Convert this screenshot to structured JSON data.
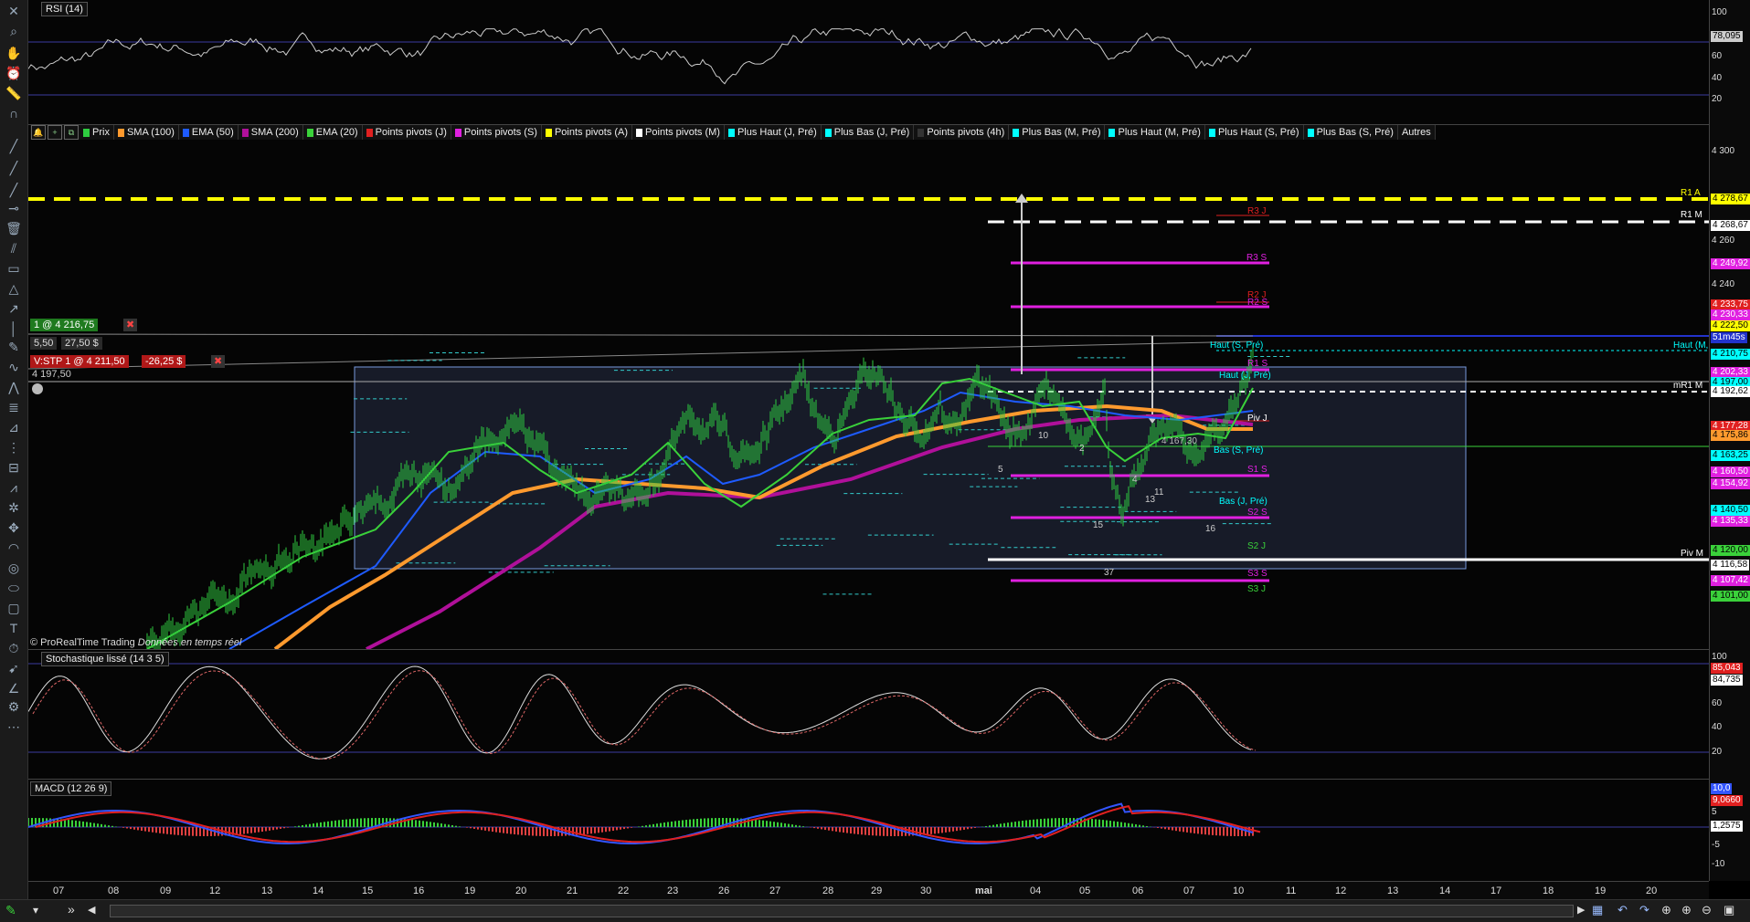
{
  "rsi_label": "RSI (14)",
  "stoch_label": "Stochastique lissé (14 3 5)",
  "macd_label": "MACD (12 26 9)",
  "watermark": "© ProRealTime Trading",
  "watermark_italic": "Données en temps réel",
  "legend": [
    {
      "label": "Prix",
      "color": "#2ecc40"
    },
    {
      "label": "SMA (100)",
      "color": "#ff9a2e"
    },
    {
      "label": "EMA (50)",
      "color": "#1e5bff"
    },
    {
      "label": "SMA (200)",
      "color": "#b0109a"
    },
    {
      "label": "EMA (20)",
      "color": "#3ad13a"
    },
    {
      "label": "Points pivots (J)",
      "color": "#e02020"
    },
    {
      "label": "Points pivots (S)",
      "color": "#e020e0"
    },
    {
      "label": "Points pivots (A)",
      "color": "#ffff00"
    },
    {
      "label": "Points pivots (M)",
      "color": "#ffffff"
    },
    {
      "label": "Plus Haut (J, Pré)",
      "color": "#00ffff"
    },
    {
      "label": "Plus Bas (J, Pré)",
      "color": "#00ffff"
    },
    {
      "label": "Points pivots (4h)",
      "color": "#333333"
    },
    {
      "label": "Plus Bas (M, Pré)",
      "color": "#00ffff"
    },
    {
      "label": "Plus Haut (M, Pré)",
      "color": "#00ffff"
    },
    {
      "label": "Plus Haut (S, Pré)",
      "color": "#00ffff"
    },
    {
      "label": "Plus Bas (S, Pré)",
      "color": "#00ffff"
    },
    {
      "label": "Autres",
      "color": ""
    }
  ],
  "orders": {
    "buy": "1 @ 4 216,75",
    "buy_sub1": "5,50",
    "buy_sub2": "27,50 $",
    "stop": "V:STP 1 @ 4 211,50",
    "stop_pnl": "-26,25 $",
    "line_price": "4 197,50"
  },
  "rsi_axis": [
    "100",
    "78,095",
    "60",
    "40",
    "20"
  ],
  "price_axis": [
    "4 300",
    "4 278,67",
    "4 268,67",
    "4 260",
    "4 249,92",
    "4 240",
    "4 233,75",
    "4 230,33",
    "4 222,50",
    "51m45s",
    "4 210,75",
    "4 202,33",
    "4 197,00",
    "4 192,62",
    "4 177,28",
    "4 175,86",
    "4 163,25",
    "4 160,50",
    "4 154,92",
    "4 140,50",
    "4 135,33",
    "4 120,00",
    "4 116,58",
    "4 107,42",
    "4 101,00"
  ],
  "stoch_axis": [
    "100",
    "85,043",
    "84,735",
    "60",
    "40",
    "20"
  ],
  "macd_axis": [
    "10,0",
    "9,0660",
    "5",
    "1,2575",
    "-5",
    "-10"
  ],
  "time_axis": [
    "07",
    "08",
    "09",
    "12",
    "13",
    "14",
    "15",
    "16",
    "19",
    "20",
    "21",
    "22",
    "23",
    "26",
    "27",
    "28",
    "29",
    "30",
    "mai",
    "04",
    "05",
    "06",
    "07",
    "10",
    "11",
    "12",
    "13",
    "14",
    "17",
    "18",
    "19",
    "20"
  ],
  "levels": {
    "r1a": "R1 A",
    "r1m": "R1 M",
    "r3j": "R3 J",
    "r3s": "R3 S",
    "r2j": "R2 J",
    "r2s": "R2 S",
    "haut_s": "Haut (S, Pré)",
    "haut_m": "Haut (M, Pré)",
    "haut_j": "Haut (J, Pré)",
    "r1s": "R1 S",
    "mr1m": "mR1 M",
    "piv_j": "Piv J",
    "bas_s": "Bas (S, Pré)",
    "s1s": "S1 S",
    "bas_j": "Bas (J, Pré)",
    "s2s": "S2 S",
    "s2j": "S2 J",
    "piv_m": "Piv M",
    "s3s": "S3 S",
    "s3j": "S3 J",
    "mid_price": "4 167,30"
  },
  "markers": [
    "5",
    "10",
    "2",
    "4",
    "13",
    "11",
    "15",
    "37",
    "16"
  ],
  "colors": {
    "yellow": "#ffff00",
    "magenta": "#e020e0",
    "white": "#ffffff",
    "cyan": "#00ffff",
    "green": "#3ad13a",
    "orange": "#ff9a2e",
    "blue": "#1e5bff",
    "purple": "#b0109a",
    "red": "#e02020"
  }
}
